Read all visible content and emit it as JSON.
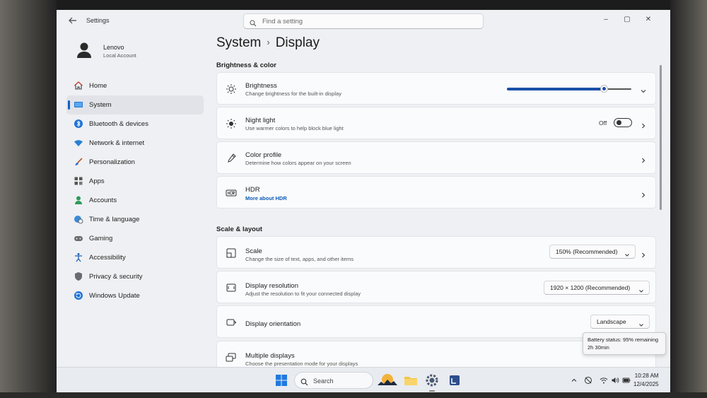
{
  "window": {
    "app_title": "Settings",
    "search_placeholder": "Find a setting",
    "minimize": "–",
    "maximize": "▢",
    "close": "✕"
  },
  "profile": {
    "name": "Lenovo",
    "account_type": "Local Account"
  },
  "sidebar": {
    "items": [
      {
        "label": "Home",
        "icon": "home-icon",
        "active": false
      },
      {
        "label": "System",
        "icon": "system-icon",
        "active": true
      },
      {
        "label": "Bluetooth & devices",
        "icon": "bluetooth-icon",
        "active": false
      },
      {
        "label": "Network & internet",
        "icon": "wifi-icon",
        "active": false
      },
      {
        "label": "Personalization",
        "icon": "brush-icon",
        "active": false
      },
      {
        "label": "Apps",
        "icon": "apps-icon",
        "active": false
      },
      {
        "label": "Accounts",
        "icon": "person-icon",
        "active": false
      },
      {
        "label": "Time & language",
        "icon": "globe-clock-icon",
        "active": false
      },
      {
        "label": "Gaming",
        "icon": "gamepad-icon",
        "active": false
      },
      {
        "label": "Accessibility",
        "icon": "accessibility-icon",
        "active": false
      },
      {
        "label": "Privacy & security",
        "icon": "shield-icon",
        "active": false
      },
      {
        "label": "Windows Update",
        "icon": "update-icon",
        "active": false
      }
    ]
  },
  "breadcrumb": {
    "parent": "System",
    "separator": "›",
    "current": "Display"
  },
  "sections": {
    "brightness_color": "Brightness & color",
    "scale_layout": "Scale & layout"
  },
  "brightness": {
    "title": "Brightness",
    "subtitle": "Change brightness for the built-in display",
    "level": 0.78
  },
  "night_light": {
    "title": "Night light",
    "subtitle": "Use warmer colors to help block blue light",
    "state_label": "Off"
  },
  "color_profile": {
    "title": "Color profile",
    "subtitle": "Determine how colors appear on your screen"
  },
  "hdr": {
    "title": "HDR",
    "link": "More about HDR"
  },
  "scale": {
    "title": "Scale",
    "subtitle": "Change the size of text, apps, and other items",
    "value": "150% (Recommended)"
  },
  "resolution": {
    "title": "Display resolution",
    "subtitle": "Adjust the resolution to fit your connected display",
    "value": "1920 × 1200 (Recommended)"
  },
  "orientation": {
    "title": "Display orientation",
    "value": "Landscape"
  },
  "multiple_displays": {
    "title": "Multiple displays",
    "subtitle": "Choose the presentation mode for your displays"
  },
  "tooltip": {
    "line1": "Battery status: 95% remaining",
    "line2": "2h 30min"
  },
  "taskbar": {
    "search_label": "Search",
    "time": "10:28 AM",
    "date": "12/4/2025"
  },
  "colors": {
    "accent": "#0f5fc6",
    "slider": "#1a4fa8"
  }
}
